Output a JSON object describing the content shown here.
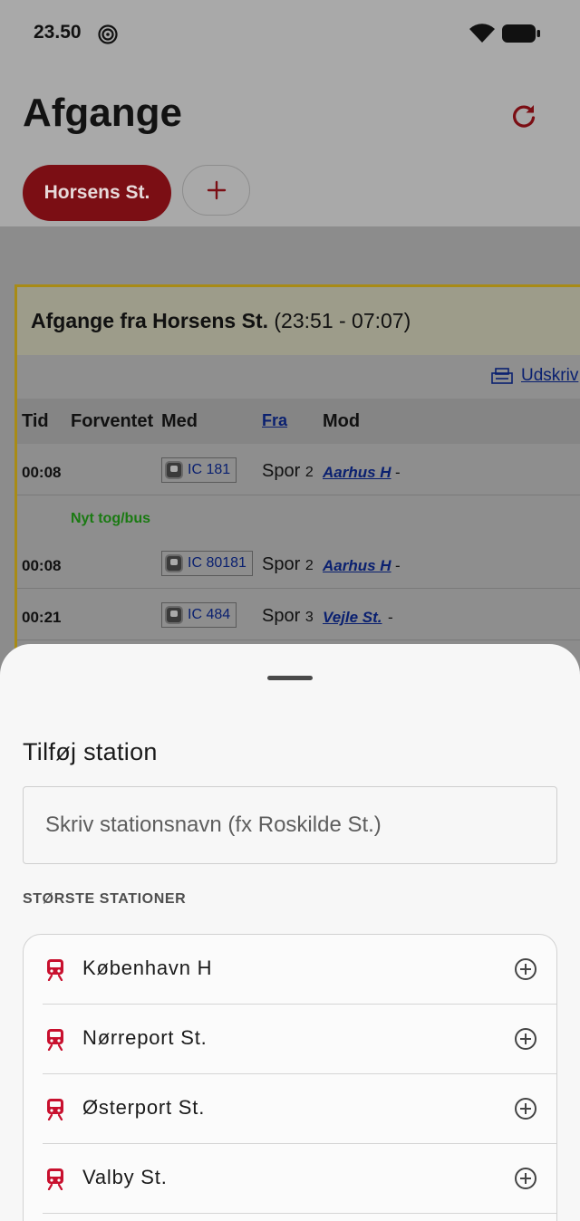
{
  "status_bar": {
    "time": "23.50"
  },
  "header": {
    "title": "Afgange",
    "chips": [
      {
        "label": "Horsens St."
      }
    ],
    "add_chip_symbol": "+"
  },
  "board": {
    "title_bold": "Afgange fra Horsens St.",
    "title_range": "(23:51 - 07:07)",
    "print_label": "Udskriv",
    "columns": {
      "tid": "Tid",
      "forventet": "Forventet",
      "med": "Med",
      "fra": "Fra",
      "mod": "Mod"
    },
    "rows": [
      {
        "time": "00:08",
        "note": "",
        "train": "IC 181",
        "spor": "Spor",
        "track": "2",
        "dest": "Aarhus H",
        "suffix": "-"
      },
      {
        "time": "00:08",
        "note": "Nyt tog/bus",
        "train": "IC 80181",
        "spor": "Spor",
        "track": "2",
        "dest": "Aarhus H",
        "suffix": "-"
      },
      {
        "time": "00:21",
        "note": "",
        "train": "IC 484",
        "spor": "Spor",
        "track": "3",
        "dest": "Vejle St.",
        "suffix": "-"
      }
    ]
  },
  "sheet": {
    "title": "Tilføj station",
    "search_placeholder": "Skriv stationsnavn (fx Roskilde St.)",
    "section_label": "STØRSTE STATIONER",
    "stations": [
      {
        "name": "København H"
      },
      {
        "name": "Nørreport St."
      },
      {
        "name": "Østerport St."
      },
      {
        "name": "Valby St."
      }
    ]
  },
  "colors": {
    "brand_red": "#c8102e",
    "chip_active": "#7b0e14",
    "note_green": "#1a7a12",
    "link_blue": "#0a2070"
  },
  "icons": {
    "status": [
      "target-icon",
      "wifi-icon",
      "battery-icon"
    ],
    "header": [
      "refresh-icon",
      "plus-icon"
    ],
    "board": [
      "printer-icon",
      "train-icon"
    ],
    "sheet": [
      "train-icon",
      "add-circle-icon"
    ]
  }
}
